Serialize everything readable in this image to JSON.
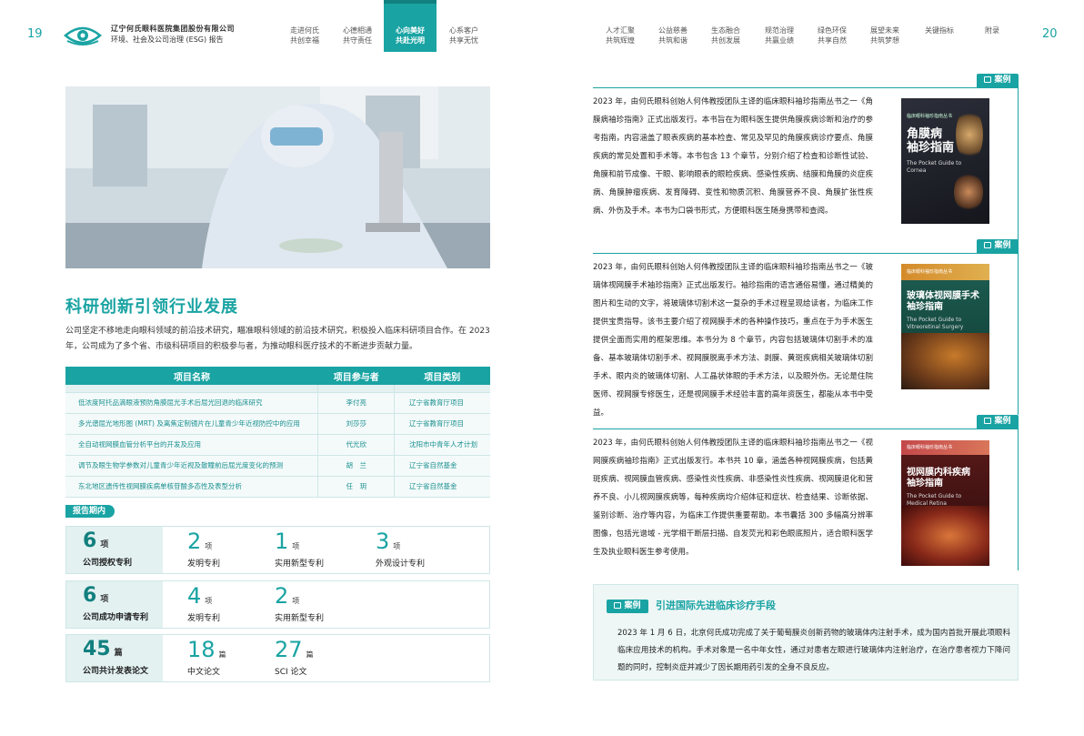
{
  "header": {
    "page_left": "19",
    "page_right": "20",
    "company_name": "辽宁何氏眼科医院集团股份有限公司",
    "report_name": "环境、社会及公司治理 (ESG) 报告",
    "nav": [
      {
        "line1": "走进何氏",
        "line2": "共创幸福"
      },
      {
        "line1": "心德相通",
        "line2": "共守责任"
      },
      {
        "line1": "心向美好",
        "line2": "共赴光明"
      },
      {
        "line1": "心系客户",
        "line2": "共享无忧"
      },
      {
        "line1": "人才汇聚",
        "line2": "共筑辉煌"
      },
      {
        "line1": "公益慈善",
        "line2": "共筑和谐"
      },
      {
        "line1": "生态融合",
        "line2": "共创发展"
      },
      {
        "line1": "规范治理",
        "line2": "共赢业绩"
      },
      {
        "line1": "绿色环保",
        "line2": "共享自然"
      },
      {
        "line1": "展望未来",
        "line2": "共筑梦想"
      },
      {
        "line1": "关键指标",
        "line2": ""
      },
      {
        "line1": "附录",
        "line2": ""
      }
    ]
  },
  "left": {
    "section_title": "科研创新引领行业发展",
    "intro": "公司坚定不移地走向眼科领域的前沿技术研究，瞄准眼科领域的前沿技术研究，积极投入临床科研项目合作。在 2023 年，公司成为了多个省、市级科研项目的积极参与者，为推动眼科医疗技术的不断进步贡献力量。",
    "table": {
      "headers": [
        "项目名称",
        "项目参与者",
        "项目类别"
      ],
      "rows": [
        [
          "低浓度阿托品滴眼液预防角膜屈光手术后屈光回退的临床研究",
          "李付亮",
          "辽宁省教育厅项目"
        ],
        [
          "多光谱屈光地形图 (MRT) 及离焦定制镜片在儿童青少年近视防控中的应用",
          "刘莎莎",
          "辽宁省教育厅项目"
        ],
        [
          "全自动视网膜血管分析平台的开发及应用",
          "代光欣",
          "沈阳市中青年人才计划"
        ],
        [
          "调节及眼生物学参数对儿童青少年近视及散瞳前后屈光度变化的预测",
          "胡　兰",
          "辽宁省自然基金"
        ],
        [
          "东北地区遗传性视网膜疾病单核苷酸多态性及表型分析",
          "任　玥",
          "辽宁省自然基金"
        ]
      ]
    },
    "period_tag": "报告期内",
    "stats": [
      {
        "main_num": "6",
        "main_unit": "项",
        "main_label": "公司授权专利",
        "subs": [
          {
            "num": "2",
            "unit": "项",
            "label": "发明专利"
          },
          {
            "num": "1",
            "unit": "项",
            "label": "实用新型专利"
          },
          {
            "num": "3",
            "unit": "项",
            "label": "外观设计专利"
          }
        ]
      },
      {
        "main_num": "6",
        "main_unit": "项",
        "main_label": "公司成功申请专利",
        "subs": [
          {
            "num": "4",
            "unit": "项",
            "label": "发明专利"
          },
          {
            "num": "2",
            "unit": "项",
            "label": "实用新型专利"
          }
        ]
      },
      {
        "main_num": "45",
        "main_unit": "篇",
        "main_label": "公司共计发表论文",
        "subs": [
          {
            "num": "18",
            "unit": "篇",
            "label": "中文论文"
          },
          {
            "num": "27",
            "unit": "篇",
            "label": "SCI 论文"
          }
        ]
      }
    ]
  },
  "right": {
    "case_label": "案例",
    "cases": [
      {
        "text": "2023 年，由何氏眼科创始人何伟教授团队主译的临床眼科袖珍指南丛书之一《角膜病袖珍指南》正式出版发行。本书旨在为眼科医生提供角膜疾病诊断和治疗的参考指南，内容涵盖了眼表疾病的基本检查、常见及罕见的角膜疾病诊疗要点、角膜疾病的常见处置和手术等。本书包含 13 个章节，分别介绍了检查和诊断性试验、角膜和前节成像、干眼、影响眼表的眼睑疾病、感染性疾病、结膜和角膜的炎症疾病、角膜肿瘤疾病、发育障碍、变性和物质沉积、角膜营养不良、角膜扩张性疾病、外伤及手术。本书为口袋书形式，方便眼科医生随身携带和查阅。",
        "book": {
          "series": "临床眼科袖珍指南丛书",
          "title_cn_1": "角膜病",
          "title_cn_2": "袖珍指南",
          "title_en_1": "The Pocket Guide to",
          "title_en_2": "Cornea"
        }
      },
      {
        "text": "2023 年，由何氏眼科创始人何伟教授团队主译的临床眼科袖珍指南丛书之一《玻璃体视网膜手术袖珍指南》正式出版发行。袖珍指南的语言通俗易懂，通过精美的图片和生动的文字，将玻璃体切割术这一复杂的手术过程呈现给读者，为临床工作提供宝贵指导。该书主要介绍了视网膜手术的各种操作技巧，重点在于为手术医生提供全面而实用的框架思维。本书分为 8 个章节，内容包括玻璃体切割手术的准备、基本玻璃体切割手术、视网膜脱离手术方法、剥膜、黄斑疾病相关玻璃体切割手术、眼内炎的玻璃体切割、人工晶状体眼的手术方法，以及眼外伤。无论是住院医师、视网膜专修医生，还是视网膜手术经验丰富的高年资医生，都能从本书中受益。",
        "book": {
          "series": "临床眼科袖珍指南丛书",
          "title_cn_1": "玻璃体视网膜手术",
          "title_cn_2": "袖珍指南",
          "title_en_1": "The Pocket Guide to",
          "title_en_2": "Vitreoretinal Surgery"
        }
      },
      {
        "text": "2023 年，由何氏眼科创始人何伟教授团队主译的临床眼科袖珍指南丛书之一《视网膜疾病袖珍指南》正式出版发行。本书共 10 章，涵盖各种视网膜疾病，包括黄斑疾病、视网膜血管疾病、感染性炎性疾病、非感染性炎性疾病、视网膜退化和营养不良、小儿视网膜疾病等，每种疾病均介绍体征和症状、检查结果、诊断依据、鉴别诊断、治疗等内容，为临床工作提供重要帮助。本书囊括 300 多幅高分辨率图像，包括光谱域 - 光学相干断层扫描、自发荧光和彩色眼底照片，适合眼科医学生及执业眼科医生参考使用。",
        "book": {
          "series": "临床眼科袖珍指南丛书",
          "title_cn_1": "视网膜内科疾病",
          "title_cn_2": "袖珍指南",
          "title_en_1": "The Pocket Guide to",
          "title_en_2": "Medical Retina"
        }
      }
    ],
    "intl": {
      "label": "案例",
      "title": "引进国际先进临床诊疗手段",
      "text": "2023 年 1 月 6 日，北京何氏成功完成了关于葡萄膜炎创新药物的玻璃体内注射手术，成为国内首批开展此项眼科临床应用技术的机构。手术对象是一名中年女性，通过对患者左眼进行玻璃体内注射治疗，在治疗患者视力下降问题的同时，控制炎症并减少了因长期用药引发的全身不良反应。"
    }
  }
}
